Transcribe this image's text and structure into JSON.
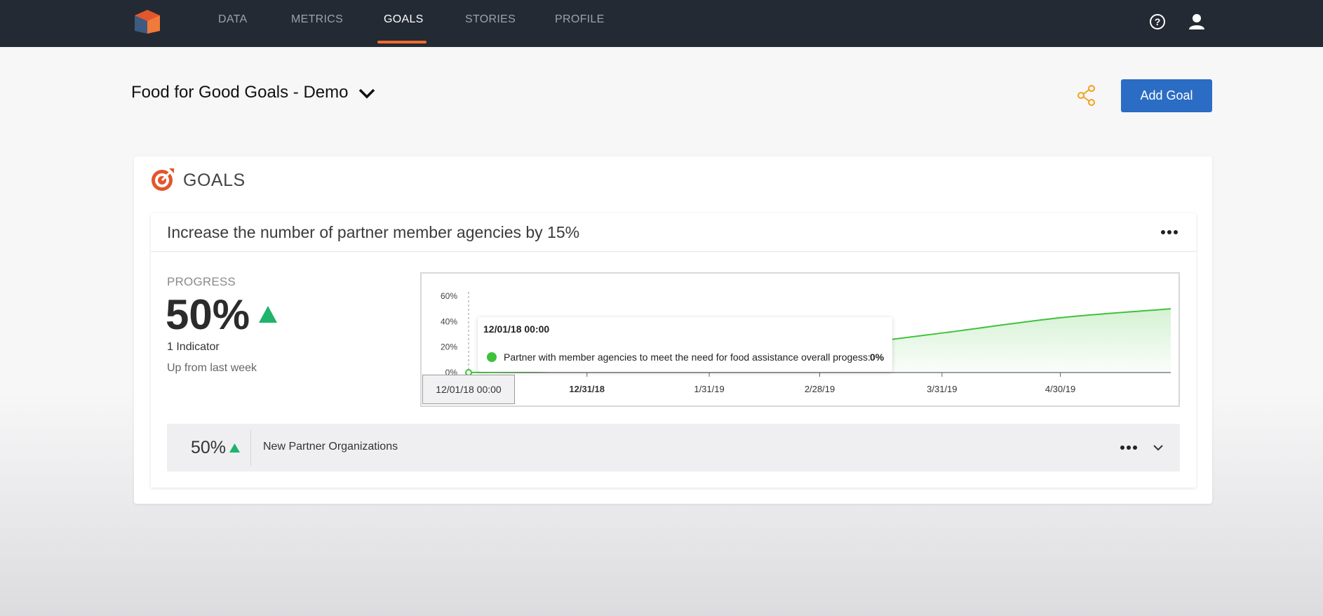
{
  "nav": {
    "items": [
      {
        "label": "DATA",
        "active": false
      },
      {
        "label": "METRICS",
        "active": false
      },
      {
        "label": "GOALS",
        "active": true
      },
      {
        "label": "STORIES",
        "active": false
      },
      {
        "label": "PROFILE",
        "active": false
      }
    ],
    "icons": [
      "help-icon",
      "user-icon"
    ]
  },
  "header": {
    "title": "Food for Good Goals - Demo",
    "add_goal_label": "Add Goal"
  },
  "goals": {
    "heading": "GOALS",
    "goal": {
      "title": "Increase the number of partner member agencies by 15%",
      "progress_label": "PROGRESS",
      "progress_value": "50%",
      "indicator_count": "1 Indicator",
      "trend": "Up from last week"
    },
    "indicator": {
      "value": "50%",
      "name": "New Partner Organizations"
    }
  },
  "tooltip": {
    "date": "12/01/18 00:00",
    "series": "Partner with member agencies to meet the need for food assistance overall progess:",
    "value": "0%"
  },
  "crosshair_label": "12/01/18 00:00",
  "colors": {
    "nav_bg": "#232a33",
    "accent": "#f26a2b",
    "button": "#2b6cc4",
    "series": "#3fc23a",
    "share": "#f2a21a"
  },
  "chart_data": {
    "type": "area",
    "x": [
      "2018-12-01",
      "2018-12-31",
      "2019-01-31",
      "2019-02-28",
      "2019-03-31",
      "2019-04-30",
      "2019-05-28"
    ],
    "series": [
      {
        "values": [
          0,
          2,
          8,
          19,
          31,
          43,
          50
        ]
      }
    ],
    "x_tick_labels": [
      "12/31/18",
      "1/31/19",
      "2/28/19",
      "3/31/19",
      "4/30/19"
    ],
    "y_tick_labels": [
      "0%",
      "20%",
      "40%",
      "60%"
    ],
    "ylim": [
      0,
      60
    ],
    "grid": false,
    "legend": "none"
  }
}
